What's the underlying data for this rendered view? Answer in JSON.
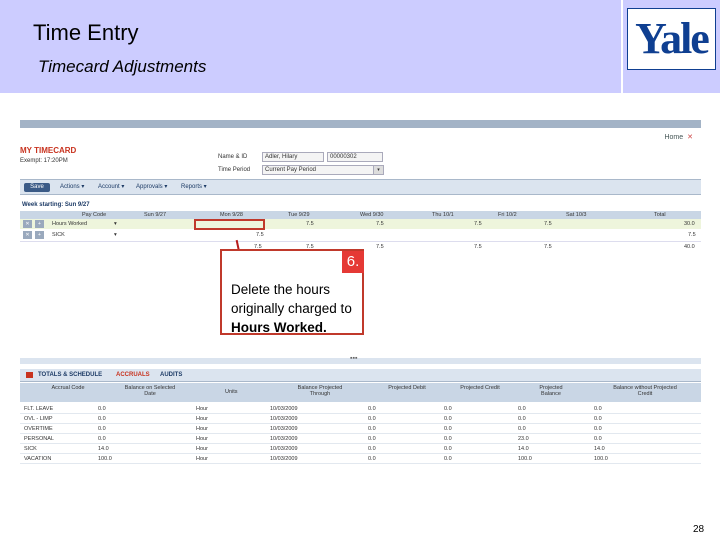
{
  "slide": {
    "title": "Time Entry",
    "subtitle": "Timecard Adjustments",
    "logo_text": "Yale",
    "page_number": "28"
  },
  "app": {
    "home_link": "Home",
    "heading": "MY TIMECARD",
    "sub_heading": "Exempt: 17:20PM",
    "name_label": "Name & ID",
    "name_value": "Adler, Hilary",
    "id_value": "00000302",
    "period_label": "Time Period",
    "period_value": "Current Pay Period",
    "toolbar": {
      "save_label": "Save",
      "menus": [
        "Actions ▾",
        "Account ▾",
        "Approvals ▾",
        "Reports ▾"
      ]
    },
    "timesheet": {
      "week_label": "Week starting: Sun 9/27",
      "columns": [
        "Pay Code",
        "Sun 9/27",
        "Mon 9/28",
        "Tue 9/29",
        "Wed 9/30",
        "Thu 10/1",
        "Fri 10/2",
        "Sat 10/3",
        "Total"
      ],
      "rows": [
        {
          "code": "Hours Worked",
          "mark": "▾",
          "values": [
            "",
            "",
            "7.5",
            "7.5",
            "7.5",
            "7.5",
            "",
            "30.0"
          ]
        },
        {
          "code": "SICK",
          "mark": "▾",
          "values": [
            "",
            "7.5",
            "",
            "",
            "",
            "",
            "",
            "7.5"
          ]
        },
        {
          "code": "",
          "mark": "",
          "values": [
            "",
            "7.5",
            "7.5",
            "7.5",
            "7.5",
            "7.5",
            "",
            "40.0"
          ]
        }
      ]
    },
    "callout": {
      "number": "6.",
      "text_before": "Delete the hours originally charged to ",
      "text_bold": "Hours Worked."
    },
    "divider_glyph": "▪▪▪",
    "bottom_tabs": [
      "TOTALS & SCHEDULE",
      "ACCRUALS",
      "AUDITS"
    ],
    "accruals": {
      "columns": [
        "Accrual Code",
        "Balance on Selected Date",
        "Units",
        "Balance Projected Through",
        "Projected Debit",
        "Projected Credit",
        "Projected Balance",
        "Balance without Projected Credit"
      ],
      "rows": [
        [
          "FLT. LEAVE",
          "0.0",
          "Hour",
          "10/03/2009",
          "0.0",
          "0.0",
          "0.0",
          "0.0"
        ],
        [
          "OVL - LIMP",
          "0.0",
          "Hour",
          "10/03/2009",
          "0.0",
          "0.0",
          "0.0",
          "0.0"
        ],
        [
          "OVERTIME",
          "0.0",
          "Hour",
          "10/03/2009",
          "0.0",
          "0.0",
          "0.0",
          "0.0"
        ],
        [
          "PERSONAL",
          "0.0",
          "Hour",
          "10/03/2009",
          "0.0",
          "0.0",
          "23.0",
          "0.0"
        ],
        [
          "SICK",
          "14.0",
          "Hour",
          "10/03/2009",
          "0.0",
          "0.0",
          "14.0",
          "14.0"
        ],
        [
          "VACATION",
          "100.0",
          "Hour",
          "10/03/2009",
          "0.0",
          "0.0",
          "100.0",
          "100.0"
        ]
      ]
    }
  }
}
